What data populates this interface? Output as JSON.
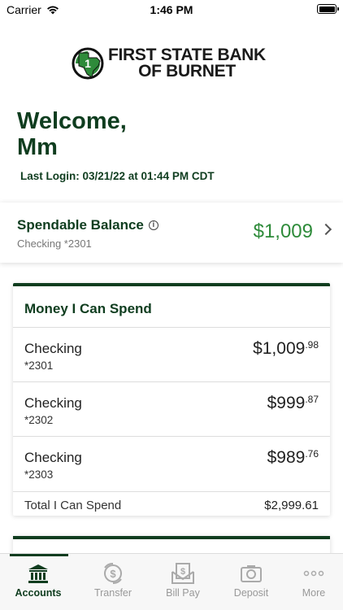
{
  "status_bar": {
    "carrier": "Carrier",
    "time": "1:46 PM"
  },
  "logo": {
    "line1": "FIRST STATE BANK",
    "line2": "OF BURNET"
  },
  "welcome": {
    "line1": "Welcome,",
    "line2": "Mm",
    "last_login": "Last Login: 03/21/22 at 01:44 PM CDT"
  },
  "spendable": {
    "title": "Spendable Balance",
    "account": "Checking *2301",
    "amount": "$1,009"
  },
  "money_card": {
    "title": "Money I Can Spend",
    "accounts": [
      {
        "name": "Checking",
        "number": "*2301",
        "dollars": "$1,009",
        "cents": ".98"
      },
      {
        "name": "Checking",
        "number": "*2302",
        "dollars": "$999",
        "cents": ".87"
      },
      {
        "name": "Checking",
        "number": "*2303",
        "dollars": "$989",
        "cents": ".76"
      }
    ],
    "total_label": "Total I Can Spend",
    "total_value": "$2,999.61"
  },
  "tabbar": {
    "tabs": [
      {
        "label": "Accounts",
        "icon": "bank-icon",
        "active": true
      },
      {
        "label": "Transfer",
        "icon": "transfer-icon",
        "active": false
      },
      {
        "label": "Bill Pay",
        "icon": "bill-pay-icon",
        "active": false
      },
      {
        "label": "Deposit",
        "icon": "deposit-icon",
        "active": false
      },
      {
        "label": "More",
        "icon": "more-icon",
        "active": false
      }
    ]
  },
  "colors": {
    "brand_green": "#0f3d1f",
    "amount_green": "#2e8b3a"
  }
}
